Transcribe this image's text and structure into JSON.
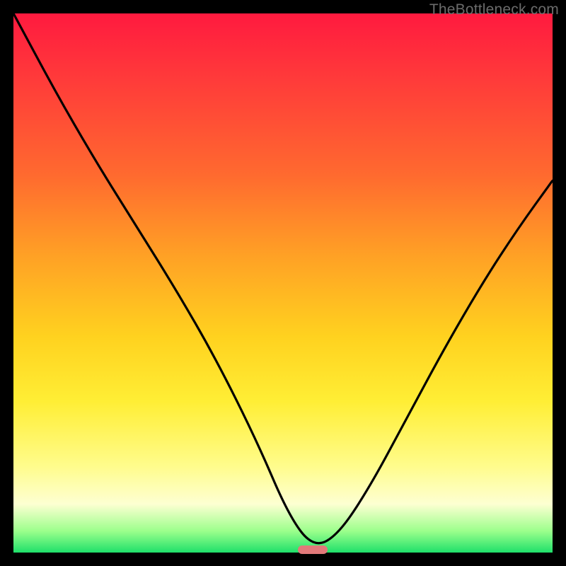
{
  "watermark": "TheBottleneck.com",
  "colors": {
    "frame": "#000000",
    "marker": "#e2797a",
    "curve_stroke": "#000000"
  },
  "chart_data": {
    "type": "line",
    "title": "",
    "xlabel": "",
    "ylabel": "",
    "xlim": [
      0,
      1
    ],
    "ylim": [
      0,
      1
    ],
    "series": [
      {
        "name": "bottleneck-curve",
        "x": [
          0.0,
          0.075,
          0.15,
          0.225,
          0.3,
          0.375,
          0.45,
          0.51,
          0.555,
          0.6,
          0.66,
          0.73,
          0.8,
          0.87,
          0.935,
          1.0
        ],
        "values": [
          1.0,
          0.86,
          0.73,
          0.61,
          0.49,
          0.36,
          0.21,
          0.07,
          0.01,
          0.03,
          0.12,
          0.25,
          0.38,
          0.5,
          0.6,
          0.69
        ]
      }
    ],
    "min_marker": {
      "x": 0.555,
      "y": 0.0
    }
  }
}
